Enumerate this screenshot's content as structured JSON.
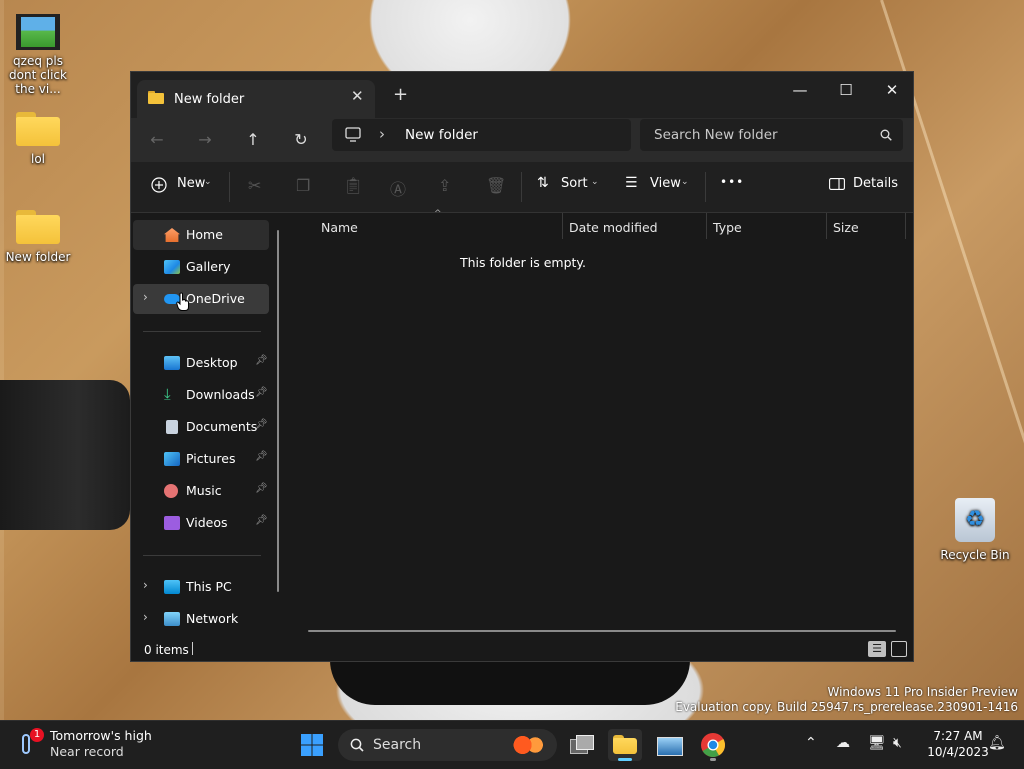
{
  "desktop": {
    "icons": [
      {
        "label": "qzeq pls dont click the vi..."
      },
      {
        "label": "lol"
      },
      {
        "label": "New folder"
      },
      {
        "label": "Recycle Bin"
      }
    ],
    "watermark_line1": "Windows 11 Pro Insider Preview",
    "watermark_line2": "Evaluation copy. Build 25947.rs_prerelease.230901-1416"
  },
  "window": {
    "tab_title": "New folder",
    "tab_close": "✕",
    "new_tab": "+",
    "controls": {
      "minimize": "—",
      "maximize": "☐",
      "close": "✕"
    },
    "nav": {
      "back": "←",
      "forward": "→",
      "up": "↑",
      "refresh": "↻"
    },
    "address": {
      "separator": "›",
      "path": "New folder"
    },
    "search": {
      "placeholder": "Search New folder"
    },
    "toolbar": {
      "new_label": "New",
      "sort_label": "Sort",
      "view_label": "View",
      "more_label": "•••",
      "details_label": "Details"
    },
    "sidebar": {
      "items": [
        {
          "label": "Home"
        },
        {
          "label": "Gallery"
        },
        {
          "label": "OneDrive"
        },
        {
          "label": "Desktop"
        },
        {
          "label": "Downloads"
        },
        {
          "label": "Documents"
        },
        {
          "label": "Pictures"
        },
        {
          "label": "Music"
        },
        {
          "label": "Videos"
        },
        {
          "label": "This PC"
        },
        {
          "label": "Network"
        }
      ]
    },
    "columns": [
      "Name",
      "Date modified",
      "Type",
      "Size"
    ],
    "empty_message": "This folder is empty.",
    "status": "0 items"
  },
  "taskbar": {
    "weather_title": "Tomorrow's high",
    "weather_sub": "Near record",
    "weather_badge": "1",
    "search_label": "Search",
    "time": "7:27 AM",
    "date": "10/4/2023"
  },
  "colors": {
    "window_bg": "#191919",
    "accent": "#60cdff",
    "folder": "#f4c23a"
  }
}
